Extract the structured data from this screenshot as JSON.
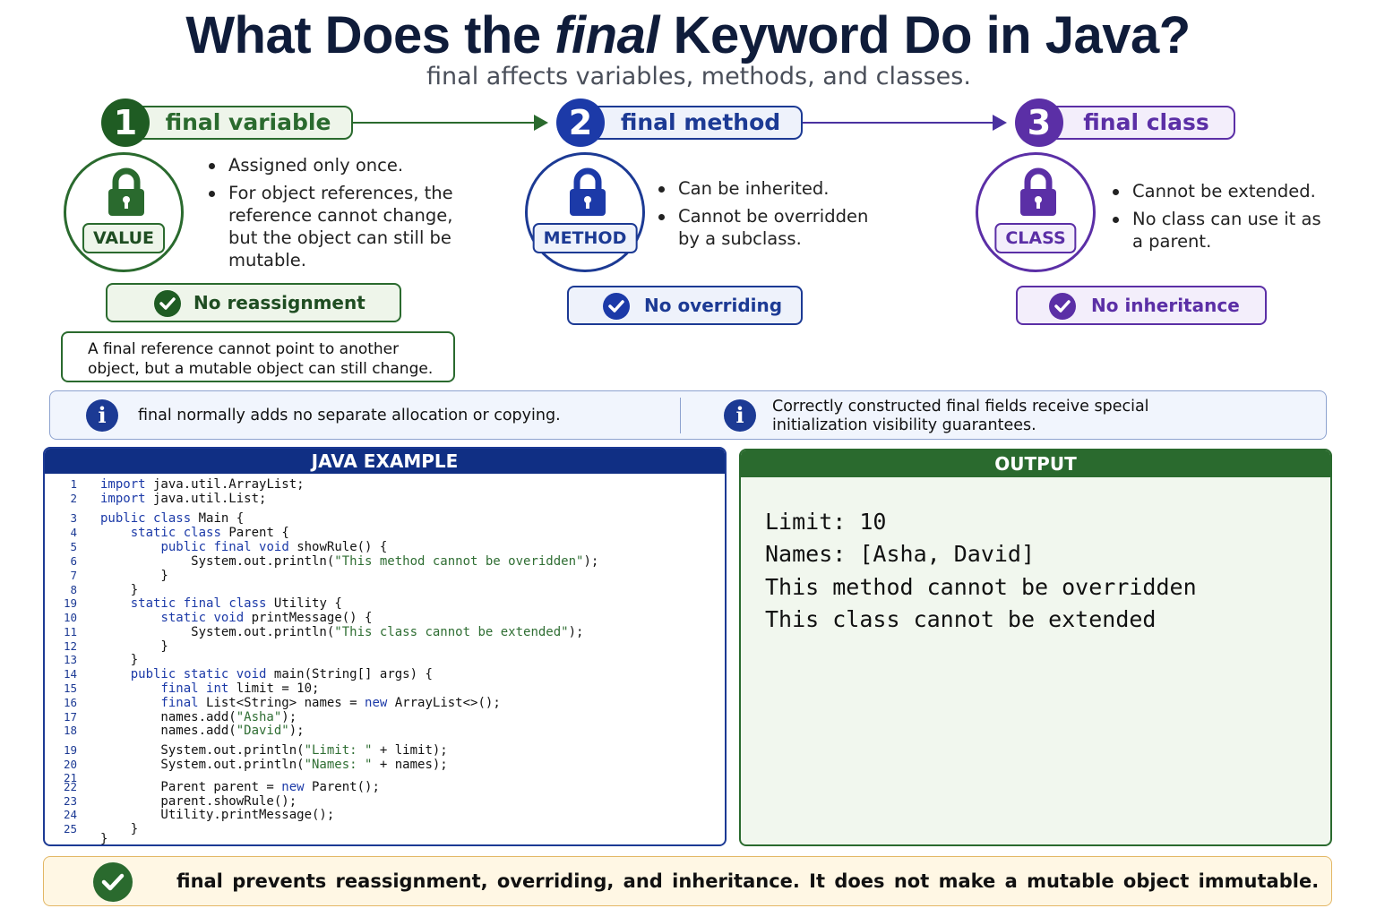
{
  "header": {
    "title_before": "What Does the ",
    "title_keyword": "final",
    "title_after": " Keyword Do in Java?",
    "subtitle": "final affects variables, methods, and classes."
  },
  "colors": {
    "green": "#2a6a2e",
    "blue": "#1c3a94",
    "purple": "#5b2fa6",
    "amber": "#e3b765"
  },
  "steps": [
    {
      "number": "1",
      "label": "final variable",
      "icon": "lock-icon",
      "tag": "VALUE",
      "bullets": [
        "Assigned only once.",
        "For object references, the reference cannot change, but the object can still be mutable."
      ],
      "badge": "No reassignment"
    },
    {
      "number": "2",
      "label": "final method",
      "icon": "lock-icon",
      "tag": "METHOD",
      "bullets": [
        "Can be inherited.",
        "Cannot be overridden by a subclass."
      ],
      "badge": "No overriding"
    },
    {
      "number": "3",
      "label": "final class",
      "icon": "lock-icon",
      "tag": "CLASS",
      "bullets": [
        "Cannot be extended.",
        "No class can use it as a parent."
      ],
      "badge": "No inheritance"
    }
  ],
  "note": "A final reference cannot point to another object, but a mutable object can still change.",
  "info": [
    "final normally adds no separate allocation or copying.",
    "Correctly constructed final fields receive special initialization visibility guarantees."
  ],
  "code": {
    "title": "JAVA EXAMPLE",
    "lines": [
      {
        "n": "1",
        "t": "import java.util.ArrayList;"
      },
      {
        "n": "2",
        "t": "import java.util.List;"
      },
      {
        "n": "3",
        "t": "public class Main {"
      },
      {
        "n": "4",
        "t": "    static class Parent {"
      },
      {
        "n": "5",
        "t": "        public final void showRule() {"
      },
      {
        "n": "6",
        "t": "            System.out.println(\"This method cannot be overidden\");"
      },
      {
        "n": "7",
        "t": "        }"
      },
      {
        "n": "8",
        "t": "    }"
      },
      {
        "n": "19",
        "t": "    static final class Utility {"
      },
      {
        "n": "10",
        "t": "        static void printMessage() {"
      },
      {
        "n": "11",
        "t": "            System.out.println(\"This class cannot be extended\");"
      },
      {
        "n": "12",
        "t": "        }"
      },
      {
        "n": "13",
        "t": "    }"
      },
      {
        "n": "14",
        "t": "    public static void main(String[] args) {"
      },
      {
        "n": "15",
        "t": "        final int limit = 10;"
      },
      {
        "n": "16",
        "t": "        final List<String> names = new ArrayList<>();"
      },
      {
        "n": "17",
        "t": "        names.add(\"Asha\");"
      },
      {
        "n": "18",
        "t": "        names.add(\"David\");"
      },
      {
        "n": "19",
        "t": "        System.out.println(\"Limit: \" + limit);"
      },
      {
        "n": "20",
        "t": "        System.out.println(\"Names: \" + names);"
      },
      {
        "n": "21",
        "t": ""
      },
      {
        "n": "22",
        "t": "        Parent parent = new Parent();"
      },
      {
        "n": "23",
        "t": "        parent.showRule();"
      },
      {
        "n": "24",
        "t": "        Utility.printMessage();"
      },
      {
        "n": "25",
        "t": "    }"
      },
      {
        "n": "",
        "t": "}"
      }
    ]
  },
  "output": {
    "title": "OUTPUT",
    "lines": [
      "Limit: 10",
      "Names: [Asha, David]",
      "This method cannot be overridden",
      "This class cannot be extended"
    ]
  },
  "footer": {
    "icon": "check-circle-icon",
    "text": "final prevents reassignment, overriding, and inheritance.  It does not make a mutable object immutable."
  }
}
